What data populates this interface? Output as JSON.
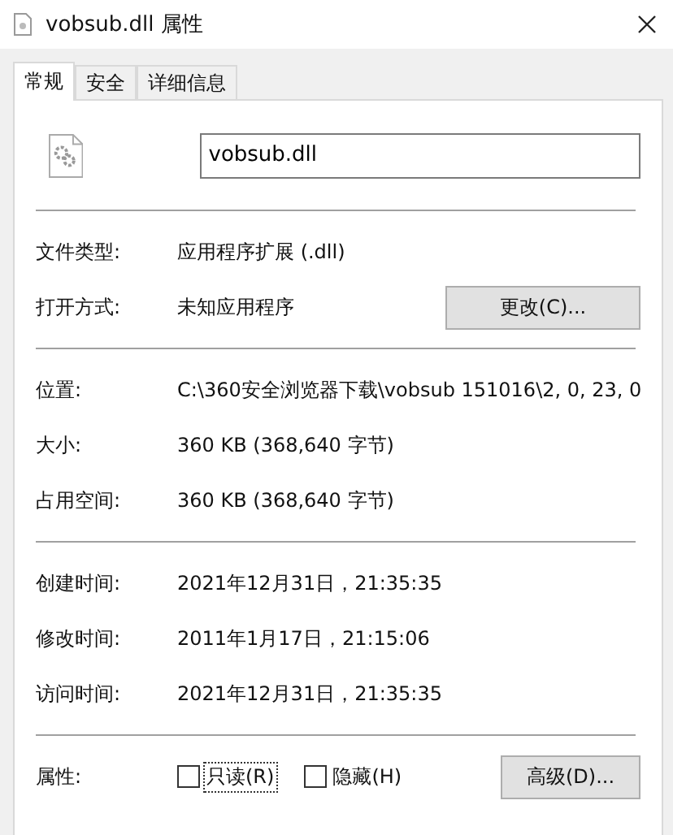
{
  "window": {
    "title": "vobsub.dll 属性"
  },
  "tabs": [
    {
      "label": "常规",
      "selected": true
    },
    {
      "label": "安全",
      "selected": false
    },
    {
      "label": "详细信息",
      "selected": false
    }
  ],
  "file_name": "vobsub.dll",
  "sections": [
    [
      {
        "label": "文件类型:",
        "value": "应用程序扩展 (.dll)"
      },
      {
        "label": "打开方式:",
        "value": "未知应用程序",
        "button": "更改(C)..."
      }
    ],
    [
      {
        "label": "位置:",
        "value": "C:\\360安全浏览器下载\\vobsub 151016\\2, 0, 23, 0"
      },
      {
        "label": "大小:",
        "value": "360 KB (368,640 字节)"
      },
      {
        "label": "占用空间:",
        "value": "360 KB (368,640 字节)"
      }
    ],
    [
      {
        "label": "创建时间:",
        "value": "2021年12月31日，21:35:35"
      },
      {
        "label": "修改时间:",
        "value": "2011年1月17日，21:15:06"
      },
      {
        "label": "访问时间:",
        "value": "2021年12月31日，21:35:35"
      }
    ]
  ],
  "attributes": {
    "label": "属性:",
    "checkboxes": [
      {
        "label": "只读(R)",
        "checked": false,
        "focused": true
      },
      {
        "label": "隐藏(H)",
        "checked": false,
        "focused": false
      }
    ],
    "button": "高级(D)..."
  }
}
